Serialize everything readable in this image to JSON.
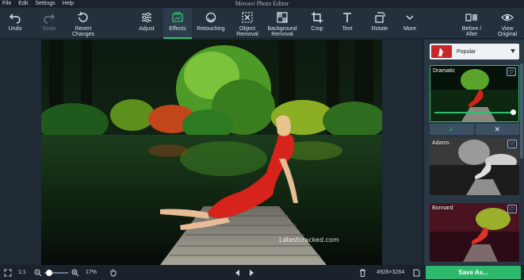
{
  "app": {
    "title": "Movavi Photo Editor"
  },
  "menu": [
    "File",
    "Edit",
    "Settings",
    "Help"
  ],
  "toolbar": {
    "undo": "Undo",
    "redo": "Redo",
    "revert_1": "Revert",
    "revert_2": "Changes",
    "adjust": "Adjust",
    "effects": "Effects",
    "retouching": "Retouching",
    "object_1": "Object",
    "object_2": "Removal",
    "background_1": "Background",
    "background_2": "Removal",
    "crop": "Crop",
    "text": "Text",
    "rotate": "Rotate",
    "more": "More",
    "before_after_1": "Before /",
    "before_after_2": "After",
    "view_1": "View",
    "view_2": "Original"
  },
  "panel": {
    "category": "Popular",
    "effects": [
      {
        "name": "Dramatic",
        "selected": true,
        "strength": 0.98
      },
      {
        "name": "Adams",
        "selected": false
      },
      {
        "name": "Bonnard",
        "selected": false
      }
    ],
    "apply_glyph": "✓",
    "cancel_glyph": "✕",
    "watermark": "Latestcracked.com"
  },
  "status": {
    "one_to_one": "1:1",
    "zoom": "17%",
    "dimensions": "4928×3264",
    "save": "Save As..."
  },
  "colors": {
    "accent": "#2eb86b",
    "dress": "#d6231b",
    "toolbar": "#24303c"
  }
}
